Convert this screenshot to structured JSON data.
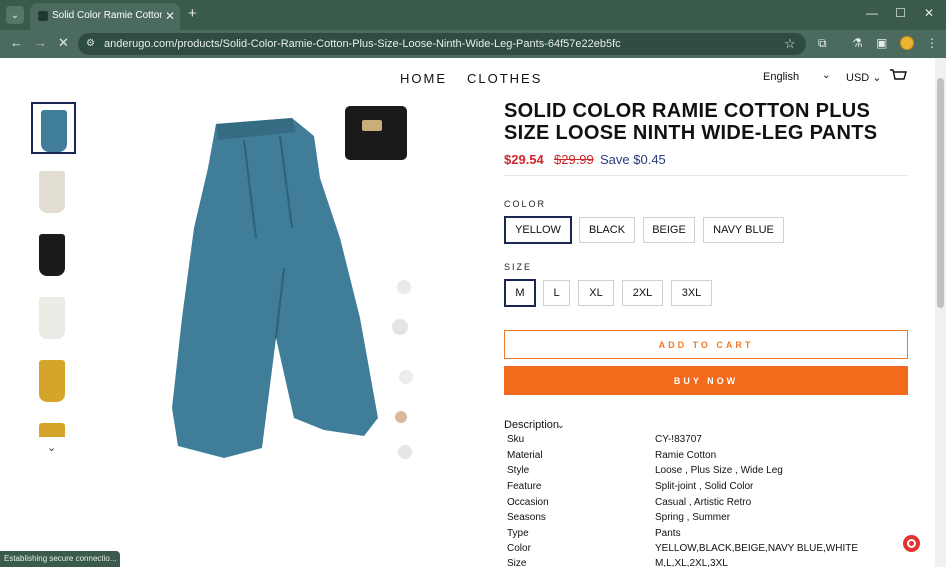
{
  "browser": {
    "tab_title": "Solid Color Ramie Cotton Plus",
    "tab_close": "✕",
    "new_tab": "+",
    "url": "anderugo.com/products/Solid-Color-Ramie-Cotton-Plus-Size-Loose-Ninth-Wide-Leg-Pants-64f57e22eb5fc",
    "status": "Establishing secure connectio...",
    "theme_color": "#4b6b5e"
  },
  "header": {
    "nav": [
      "HOME",
      "CLOTHES"
    ],
    "language": "English",
    "currency": "USD"
  },
  "gallery": {
    "thumbnail_colors": [
      "#3f7d98",
      "#e2ddd3",
      "#1b1b1b",
      "#ecebe6",
      "#d4a52a",
      "#d4a52a"
    ]
  },
  "product": {
    "title": "SOLID COLOR RAMIE COTTON PLUS SIZE LOOSE NINTH WIDE-LEG PANTS",
    "price": "$29.54",
    "compare_price": "$29.99",
    "save": "Save $0.45",
    "color_label": "COLOR",
    "colors": [
      "YELLOW",
      "BLACK",
      "BEIGE",
      "NAVY BLUE"
    ],
    "size_label": "SIZE",
    "sizes": [
      "M",
      "L",
      "XL",
      "2XL",
      "3XL"
    ],
    "add_to_cart": "ADD TO CART",
    "buy_now": "BUY NOW",
    "accent_color": "#f26a1b",
    "price_color": "#d1262a"
  },
  "description": {
    "heading": "Description",
    "specs": [
      {
        "key": "Sku",
        "value": "CY-!83707"
      },
      {
        "key": "Material",
        "value": "Ramie Cotton"
      },
      {
        "key": "Style",
        "value": "Loose , Plus Size , Wide Leg"
      },
      {
        "key": "Feature",
        "value": "Split-joint , Solid Color"
      },
      {
        "key": "Occasion",
        "value": "Casual , Artistic Retro"
      },
      {
        "key": "Seasons",
        "value": "Spring , Summer"
      },
      {
        "key": "Type",
        "value": "Pants"
      },
      {
        "key": "Color",
        "value": "YELLOW,BLACK,BEIGE,NAVY BLUE,WHITE"
      },
      {
        "key": "Size",
        "value": "M,L,XL,2XL,3XL"
      }
    ]
  }
}
